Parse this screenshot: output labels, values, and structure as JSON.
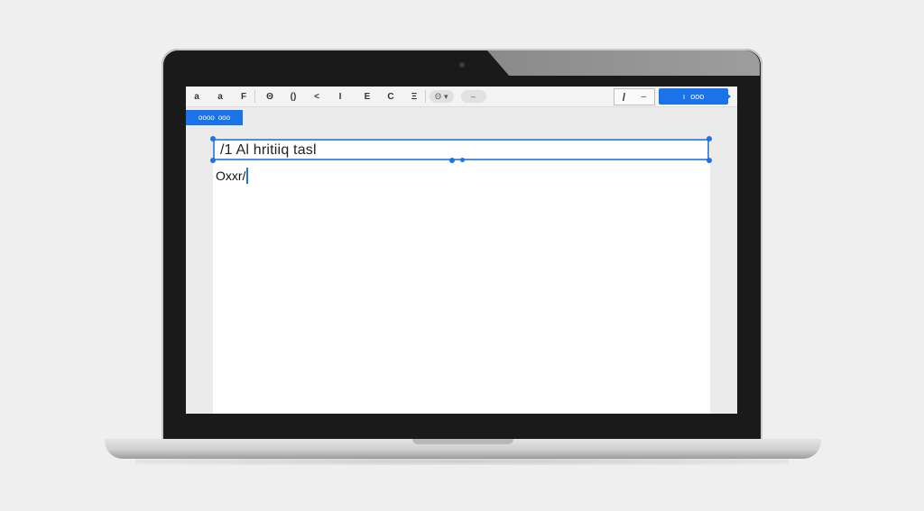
{
  "toolbar": {
    "buttons": [
      "a",
      "a",
      "F",
      "Θ",
      "()",
      "<",
      "I",
      "E",
      "C",
      "Ξ"
    ],
    "font_pill": "Θ",
    "font_arrow": "▾",
    "style_pill": "–",
    "pen_glyph": "/",
    "pen_menu": "–"
  },
  "share": {
    "label": "ooo",
    "prefix": "ı"
  },
  "side_tab": {
    "label": "oooo",
    "extra": "ooo"
  },
  "document": {
    "title": "/1  Al hritiiq tasl",
    "body": "Oxxr/"
  }
}
